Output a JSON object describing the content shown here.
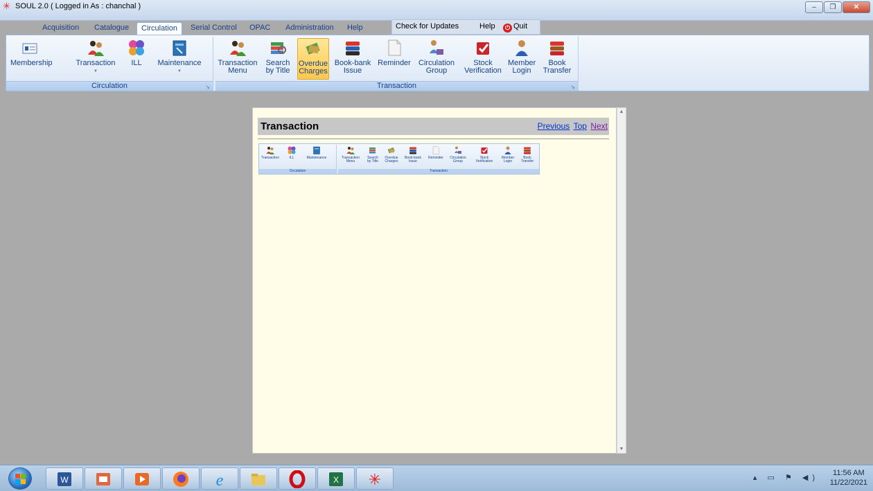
{
  "window": {
    "title": "SOUL 2.0  ( Logged in As : chanchal )",
    "controls": [
      "minimize",
      "maximize",
      "close"
    ]
  },
  "menu": {
    "tabs": [
      "Acquisition",
      "Catalogue",
      "Circulation",
      "Serial Control",
      "OPAC",
      "Administration",
      "Help"
    ],
    "active_tab": "Circulation",
    "quick_access": {
      "check_updates": "Check for Updates",
      "help": "Help",
      "quit": "Quit"
    }
  },
  "ribbon": {
    "circulation_group": {
      "label": "Circulation",
      "buttons": [
        {
          "label": "Membership",
          "icon": "membership-card-icon"
        },
        {
          "label": "Transaction",
          "icon": "people-transaction-icon"
        },
        {
          "label": "ILL",
          "icon": "ill-puzzle-icon"
        },
        {
          "label": "Maintenance",
          "icon": "maintenance-book-icon"
        }
      ]
    },
    "transaction_group": {
      "label": "Transaction",
      "buttons": [
        {
          "label1": "Transaction",
          "label2": "Menu",
          "icon": "transaction-menu-icon"
        },
        {
          "label1": "Search",
          "label2": "by Title",
          "icon": "search-by-title-icon"
        },
        {
          "label1": "Overdue",
          "label2": "Charges",
          "icon": "overdue-charges-icon"
        },
        {
          "label1": "Book-bank",
          "label2": "Issue",
          "icon": "book-bank-icon"
        },
        {
          "label1": "Reminder",
          "label2": "",
          "icon": "reminder-icon"
        },
        {
          "label1": "Circulation",
          "label2": "Group",
          "icon": "circulation-group-icon"
        },
        {
          "label1": "Stock",
          "label2": "Verification",
          "icon": "stock-verification-icon"
        },
        {
          "label1": "Member",
          "label2": "Login",
          "icon": "member-login-icon"
        },
        {
          "label1": "Book",
          "label2": "Transfer",
          "icon": "book-transfer-icon"
        }
      ]
    }
  },
  "help_doc": {
    "title": "Transaction",
    "nav": {
      "previous": "Previous",
      "top": "Top",
      "next": "Next"
    },
    "mini_circulation": {
      "label": "Circulation",
      "buttons": [
        "Transaction",
        "ILL",
        "Maintenance"
      ]
    },
    "mini_transaction": {
      "label": "Transaction",
      "buttons": [
        {
          "l1": "Transaction",
          "l2": "Menu"
        },
        {
          "l1": "Search",
          "l2": "by Title"
        },
        {
          "l1": "Overdue",
          "l2": "Charges"
        },
        {
          "l1": "Book-bank",
          "l2": "Issue"
        },
        {
          "l1": "Reminder",
          "l2": ""
        },
        {
          "l1": "Circulation",
          "l2": "Group"
        },
        {
          "l1": "Stock",
          "l2": "Verification"
        },
        {
          "l1": "Member",
          "l2": "Login"
        },
        {
          "l1": "Book",
          "l2": "Transfer"
        }
      ]
    }
  },
  "taskbar": {
    "apps": [
      "word-icon",
      "presentation-icon",
      "media-player-icon",
      "firefox-icon",
      "internet-explorer-icon",
      "file-explorer-icon",
      "opera-icon",
      "excel-icon",
      "soul-app-icon"
    ],
    "time": "11:56 AM",
    "date": "11/22/2021"
  },
  "colors": {
    "ribbon_text": "#15428b",
    "active_button": "#ffc84a",
    "help_background": "#fffde8",
    "link": "#0033cc",
    "visited_link": "#7a1fa2"
  }
}
